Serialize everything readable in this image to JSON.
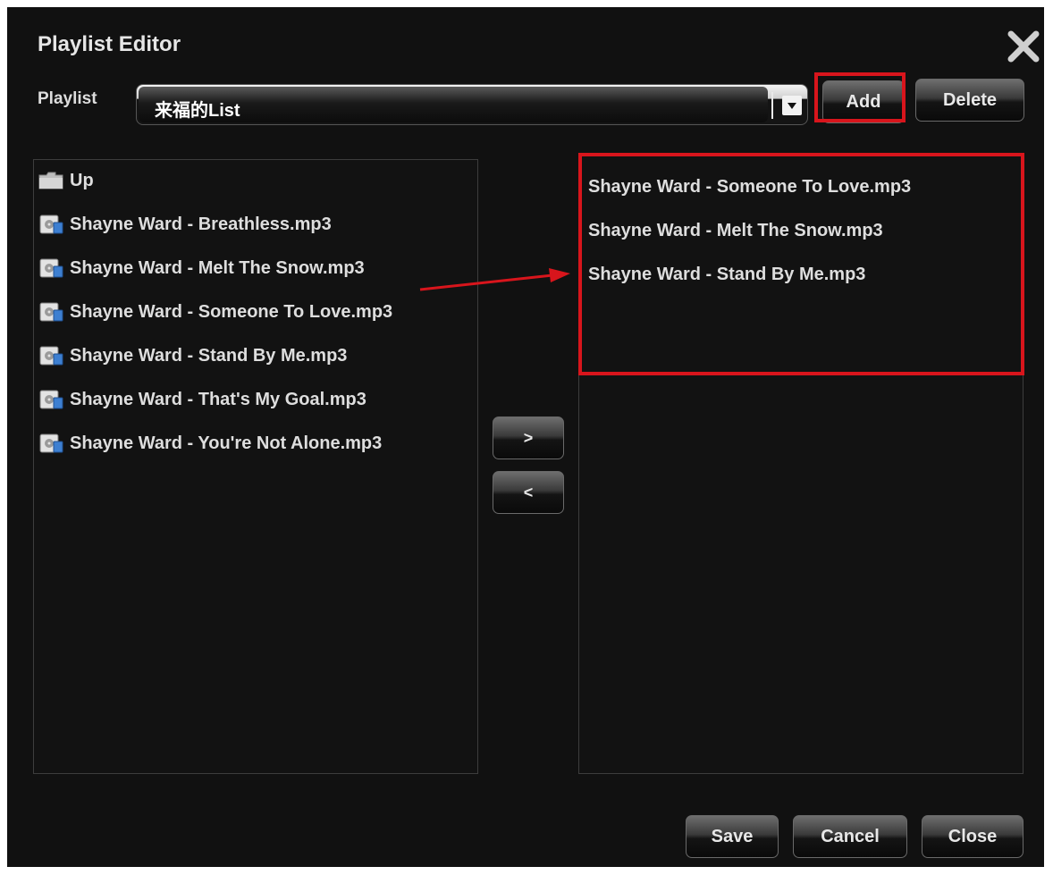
{
  "dialog": {
    "title": "Playlist Editor",
    "close_icon": "close-icon"
  },
  "playlist": {
    "label": "Playlist",
    "selected_value": "来福的List",
    "add_label": "Add",
    "delete_label": "Delete"
  },
  "left_panel": {
    "up_label": "Up",
    "files": [
      "Shayne Ward - Breathless.mp3",
      "Shayne Ward - Melt The Snow.mp3",
      "Shayne Ward - Someone To Love.mp3",
      "Shayne Ward - Stand By Me.mp3",
      "Shayne Ward - That's My Goal.mp3",
      "Shayne Ward - You're Not Alone.mp3"
    ]
  },
  "transfer": {
    "move_right_label": ">",
    "move_left_label": "<"
  },
  "right_panel": {
    "files": [
      "Shayne Ward - Someone To Love.mp3",
      "Shayne Ward - Melt The Snow.mp3",
      "Shayne Ward - Stand By Me.mp3"
    ]
  },
  "footer": {
    "save_label": "Save",
    "cancel_label": "Cancel",
    "close_label": "Close"
  },
  "colors": {
    "background": "#111111",
    "highlight": "#d8151c",
    "text": "#dedede"
  }
}
